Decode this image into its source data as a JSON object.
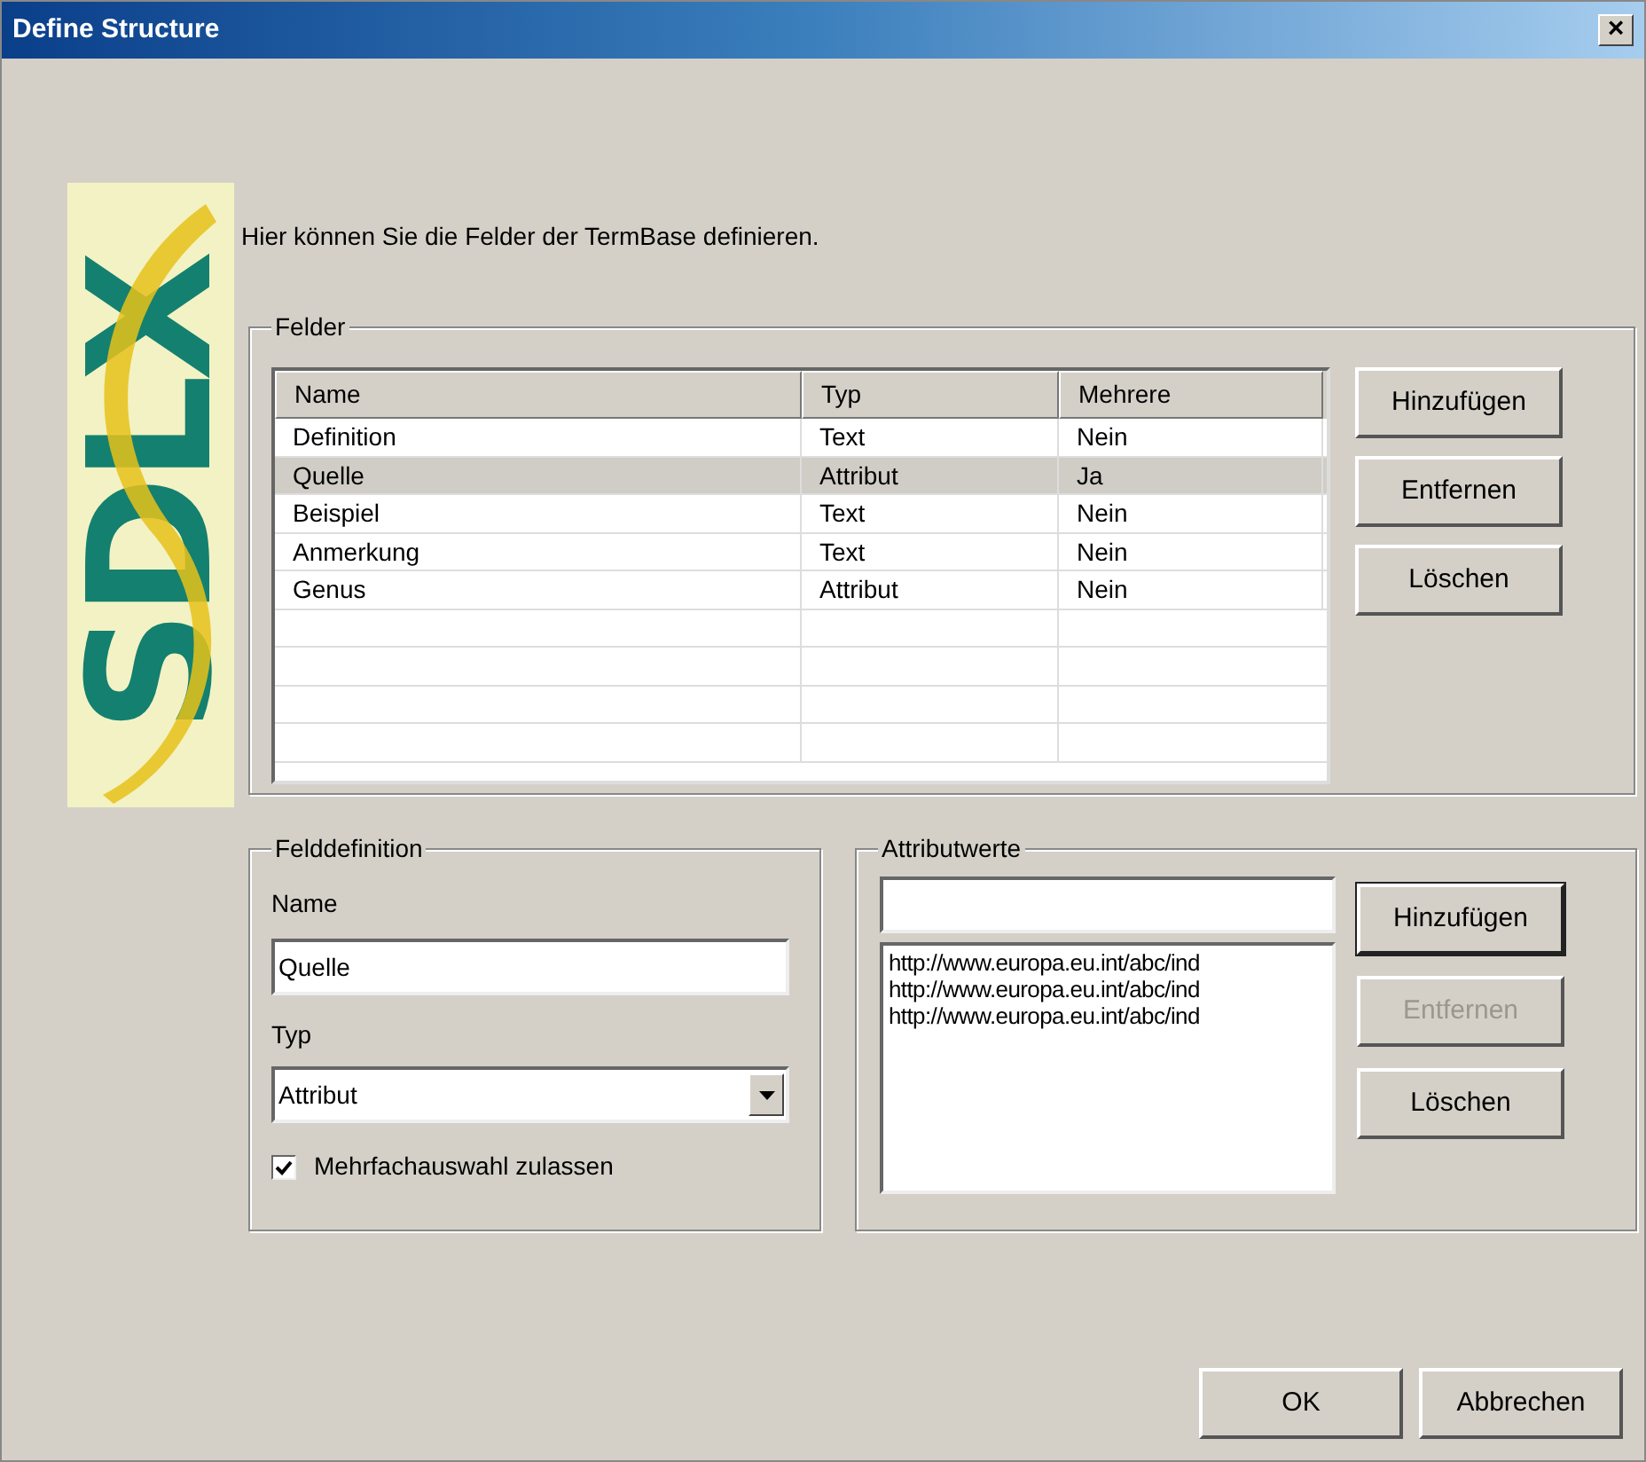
{
  "window": {
    "title": "Define Structure",
    "close": "×"
  },
  "logo": {
    "text": "SDLX"
  },
  "intro": "Hier können Sie die Felder der TermBase definieren.",
  "fields_group": {
    "title": "Felder",
    "table": {
      "columns": [
        "Name",
        "Typ",
        "Mehrere"
      ],
      "rows": [
        {
          "cells": [
            "Definition",
            "Text",
            "Nein"
          ],
          "selected": false
        },
        {
          "cells": [
            "Quelle",
            "Attribut",
            "Ja"
          ],
          "selected": true
        },
        {
          "cells": [
            "Beispiel",
            "Text",
            "Nein"
          ],
          "selected": false
        },
        {
          "cells": [
            "Anmerkung",
            "Text",
            "Nein"
          ],
          "selected": false
        },
        {
          "cells": [
            "Genus",
            "Attribut",
            "Nein"
          ],
          "selected": false
        }
      ]
    },
    "buttons": [
      {
        "label": "Hinzufügen",
        "disabled": false,
        "default": false
      },
      {
        "label": "Entfernen",
        "disabled": false,
        "default": false
      },
      {
        "label": "Löschen",
        "disabled": false,
        "default": false
      }
    ]
  },
  "field_definition": {
    "title": "Felddefinition",
    "name_label": "Name",
    "name_value": "Quelle",
    "type_label": "Typ",
    "type_value": "Attribut",
    "multi_select": {
      "label": "Mehrfachauswahl zulassen",
      "checked": true
    }
  },
  "attribute_values": {
    "title": "Attributwerte",
    "items": [
      "http://www.europa.eu.int/abc/ind",
      "http://www.europa.eu.int/abc/ind",
      "http://www.europa.eu.int/abc/ind"
    ],
    "buttons": [
      {
        "label": "Hinzufügen",
        "disabled": false,
        "default": true
      },
      {
        "label": "Entfernen",
        "disabled": true,
        "default": false
      },
      {
        "label": "Löschen",
        "disabled": false,
        "default": false
      }
    ]
  },
  "footer_buttons": [
    {
      "label": "OK",
      "disabled": false,
      "default": false
    },
    {
      "label": "Abbrechen",
      "disabled": false,
      "default": false
    }
  ]
}
